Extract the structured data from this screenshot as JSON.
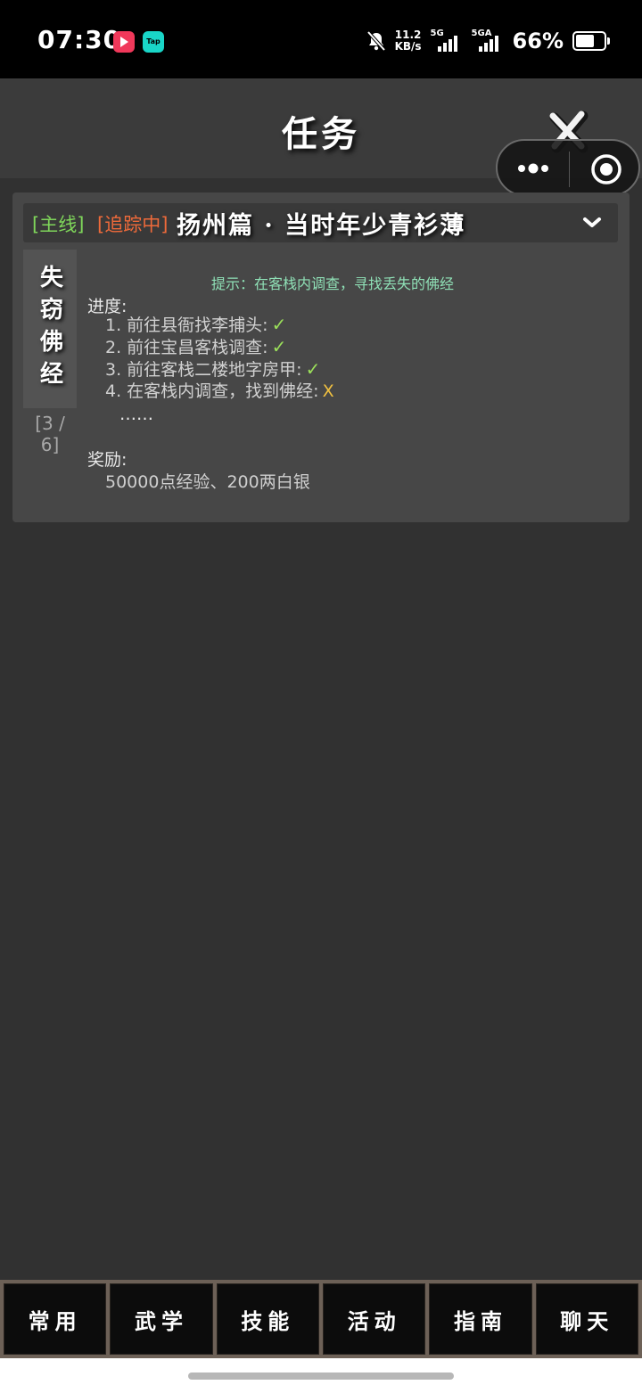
{
  "status_bar": {
    "time": "07:30",
    "app_badge": "Tap",
    "speed_value": "11.2",
    "speed_unit": "KB/s",
    "net1": "5G",
    "net2": "5GA",
    "battery": "66%"
  },
  "header": {
    "title": "任务"
  },
  "quest": {
    "tag_main": "[主线]",
    "tag_tracking": "[追踪中]",
    "title": "扬州篇 · 当时年少青衫薄",
    "side_title": "失窃佛经",
    "step_count": "[3 / 6]",
    "hint": "提示：在客栈内调查，寻找丢失的佛经",
    "progress_label": "进度:",
    "progress": [
      {
        "text": "1. 前往县衙找李捕头:",
        "mark": "✓",
        "done": true
      },
      {
        "text": "2. 前往宝昌客栈调查:",
        "mark": "✓",
        "done": true
      },
      {
        "text": "3. 前往客栈二楼地字房甲:",
        "mark": "✓",
        "done": true
      },
      {
        "text": "4. 在客栈内调查，找到佛经:",
        "mark": "X",
        "done": false
      }
    ],
    "ellipsis": "……",
    "reward_label": "奖励:",
    "reward": "50000点经验、200两白银"
  },
  "bottom_nav": [
    {
      "label": "常用"
    },
    {
      "label": "武学"
    },
    {
      "label": "技能"
    },
    {
      "label": "活动"
    },
    {
      "label": "指南"
    },
    {
      "label": "聊天"
    }
  ],
  "colors": {
    "background": "#313131",
    "card": "#474747",
    "tag_main": "#7fd65a",
    "tag_tracking": "#ef6a3a",
    "hint": "#8fe0b6",
    "done_mark": "#9be05a",
    "pending_mark": "#f0c040"
  }
}
